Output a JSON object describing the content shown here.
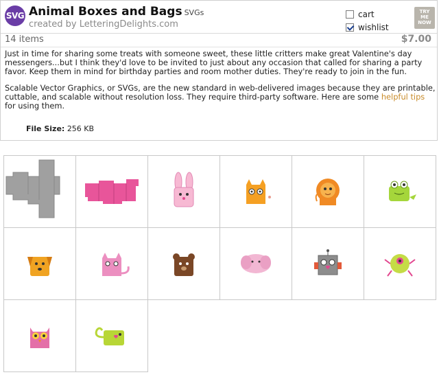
{
  "product": {
    "badge": "SVG",
    "title": "Animal Boxes and Bags",
    "type": "SVGs",
    "creator": "created by LetteringDelights.com",
    "cart_label": "cart",
    "wishlist_label": "wishlist",
    "cart_checked": false,
    "wishlist_checked": true,
    "try_label_1": "TRY",
    "try_label_2": "ME",
    "try_label_3": "NOW",
    "items": "14 items",
    "price": "$7.00",
    "description_1": "Just in time for sharing some treats with someone sweet, these little critters make great Valentine's day messengers...but I think they'd love to be invited to just about any occasion that called for sharing a party favor. Keep them in mind for birthday parties and room mother duties. They're ready to join in the fun.",
    "description_2_pre": "Scalable Vector Graphics, or SVGs, are the new standard in web-delivered images because they are printable, cuttable, and scalable without resolution loss. They require third-party software. Here are some ",
    "description_2_link": "helpful tips",
    "description_2_post": " for using them.",
    "file_size_label": "File Size:",
    "file_size_value": "256 KB"
  },
  "thumbnails": [
    {
      "name": "gray-box-template-thumb",
      "color": "#9b9b9b"
    },
    {
      "name": "pink-bag-template-thumb",
      "color": "#e8559a"
    },
    {
      "name": "bunny-thumb",
      "color": "#f7b9d3"
    },
    {
      "name": "cat-orange-thumb",
      "color": "#f5a023"
    },
    {
      "name": "lion-thumb",
      "color": "#f08a24"
    },
    {
      "name": "frog-thumb",
      "color": "#a5d63b"
    },
    {
      "name": "dog-thumb",
      "color": "#f0a322"
    },
    {
      "name": "cat-pink-thumb",
      "color": "#ec8fc0"
    },
    {
      "name": "bear-thumb",
      "color": "#7a4726"
    },
    {
      "name": "elephant-thumb",
      "color": "#f2b7d3"
    },
    {
      "name": "robot-thumb",
      "color": "#8d8d8d"
    },
    {
      "name": "monster-thumb",
      "color": "#c5dc46"
    },
    {
      "name": "owl-thumb",
      "color": "#e46fa8"
    },
    {
      "name": "chameleon-thumb",
      "color": "#b8d636"
    }
  ]
}
